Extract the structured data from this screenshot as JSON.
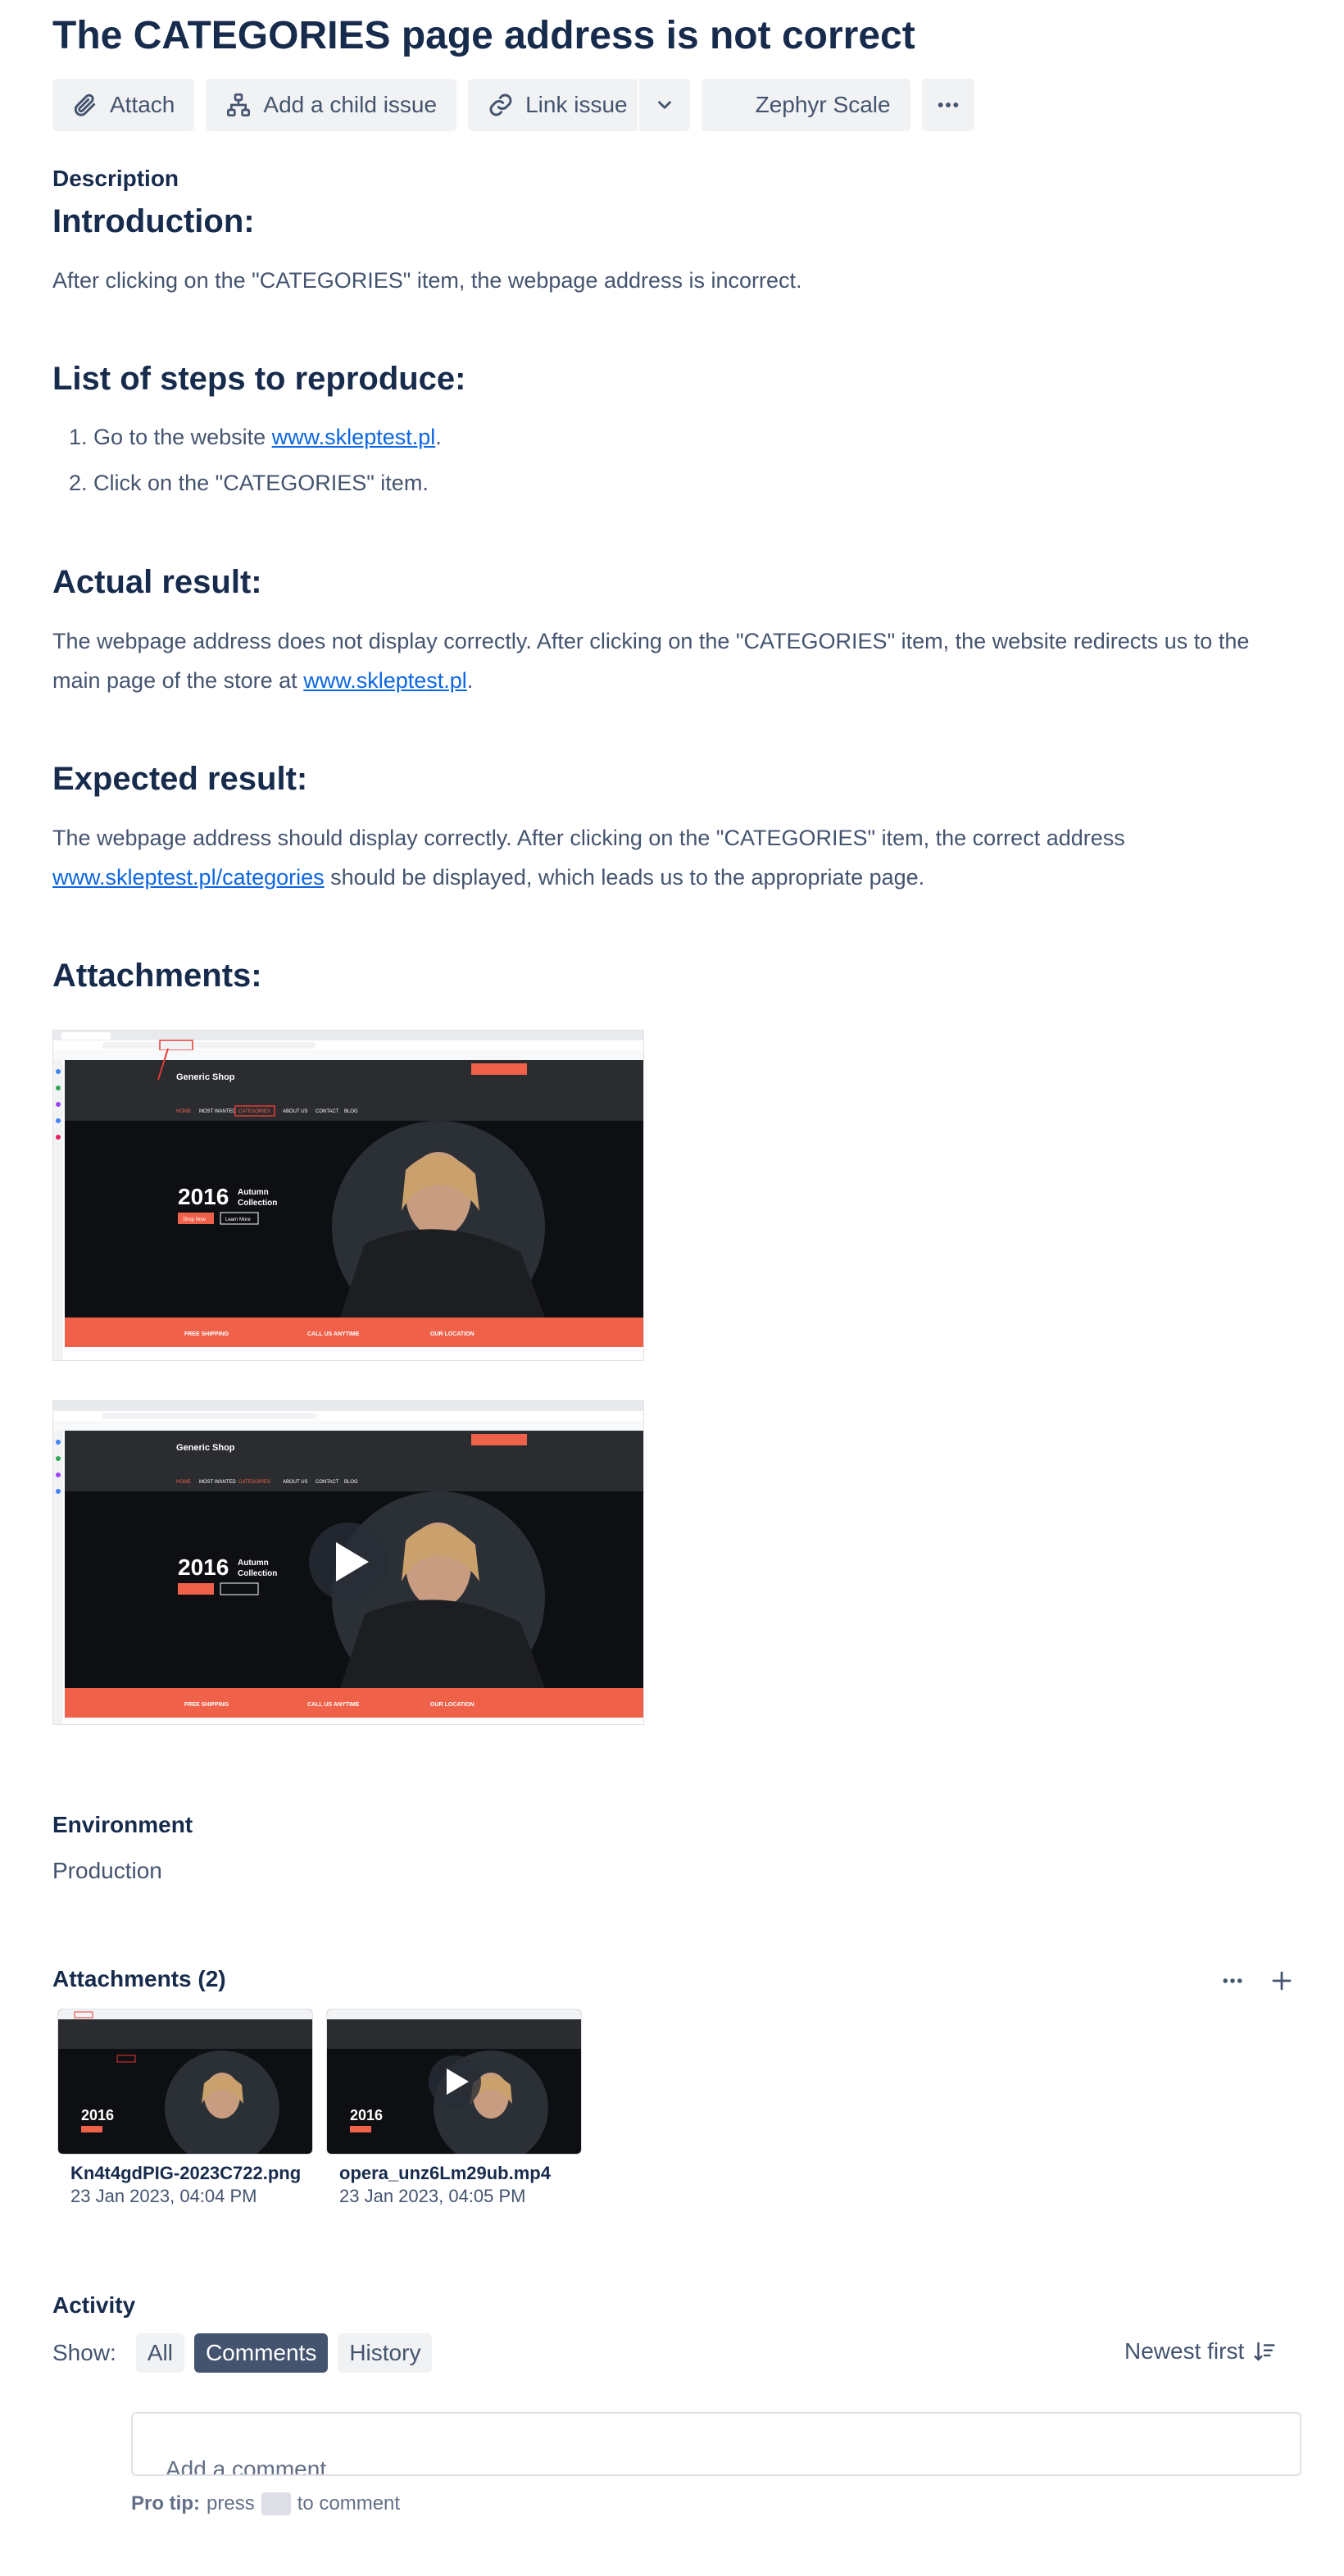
{
  "issue": {
    "title": "The CATEGORIES page address is not correct"
  },
  "toolbar": {
    "attach": "Attach",
    "add_child": "Add a child issue",
    "link_issue": "Link issue",
    "zephyr": "Zephyr Scale"
  },
  "description": {
    "label": "Description",
    "introduction_heading": "Introduction:",
    "introduction_text": "After clicking on the \"CATEGORIES\" item, the webpage address is incorrect.",
    "steps_heading": "List of steps to reproduce:",
    "steps": [
      {
        "num": "1.",
        "prefix": "Go to the website ",
        "link": "www.skleptest.pl",
        "suffix": "."
      },
      {
        "num": "2.",
        "text": "Click on the \"CATEGORIES\" item."
      }
    ],
    "actual_heading": "Actual result:",
    "actual_text_1": "The webpage address does not display correctly. After clicking on the \"CATEGORIES\" item, the website redirects us to the",
    "actual_text_2_prefix": "main page of the store at ",
    "actual_link": "www.skleptest.pl",
    "actual_text_2_suffix": ".",
    "expected_heading": "Expected result:",
    "expected_text_1": "The webpage address should display correctly. After clicking on the \"CATEGORIES\" item, the correct address",
    "expected_link": "www.skleptest.pl/categories",
    "expected_text_2_suffix": " should be displayed, which leads us to the appropriate page.",
    "attachments_heading": "Attachments:"
  },
  "screenshot": {
    "brand": "Generic Shop",
    "nav": [
      "HOME",
      "MOST WANTED",
      "CATEGORIES",
      "ABOUT US",
      "CONTACT",
      "BLOG"
    ],
    "hero_year": "2016",
    "hero_line1": "Autumn",
    "hero_line2": "Collection",
    "hero_btn1": "Shop Now",
    "hero_btn2": "Learn More",
    "footer": [
      "FREE SHIPPING",
      "CALL US ANYTIME",
      "OUR LOCATION"
    ]
  },
  "environment": {
    "label": "Environment",
    "value": "Production"
  },
  "attachments_panel": {
    "heading": "Attachments (2)",
    "files": [
      {
        "name": "Kn4t4gdPIG-2023C722.png",
        "date": "23 Jan 2023, 04:04 PM"
      },
      {
        "name": "opera_unz6Lm29ub.mp4",
        "date": "23 Jan 2023, 04:05 PM"
      }
    ]
  },
  "activity": {
    "heading": "Activity",
    "show_label": "Show:",
    "filters": [
      "All",
      "Comments",
      "History"
    ],
    "active_filter": "Comments",
    "sort": "Newest first",
    "comment_placeholder": "Add a comment…",
    "protip_bold": "Pro tip:",
    "protip_press": "press",
    "protip_suffix": "to comment"
  },
  "colors": {
    "accent": "#0c66e4",
    "shop_red": "#f0614a",
    "text": "#172b4d",
    "subtle": "#44546f"
  }
}
